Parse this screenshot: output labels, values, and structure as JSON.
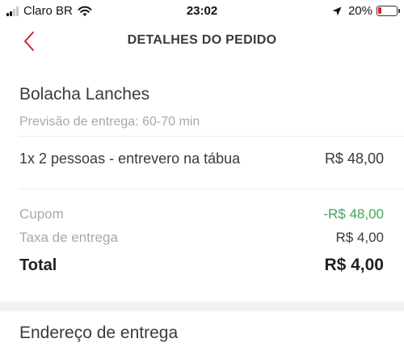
{
  "status_bar": {
    "carrier": "Claro BR",
    "time": "23:02",
    "battery_percent": "20%",
    "battery_level": 0.2,
    "icons": [
      "signal-icon",
      "wifi-icon",
      "location-arrow-icon",
      "battery-icon"
    ]
  },
  "nav": {
    "title": "DETALHES DO PEDIDO",
    "back_icon": "chevron-left-icon",
    "accent_color": "#c8262d"
  },
  "order": {
    "restaurant": "Bolacha Lanches",
    "eta": "Previsão de entrega: 60-70 min",
    "items": [
      {
        "description": "1x 2 pessoas - entrevero na tábua",
        "price": "R$ 48,00"
      }
    ],
    "summary": {
      "coupon_label": "Cupom",
      "coupon_value": "-R$ 48,00",
      "delivery_label": "Taxa de entrega",
      "delivery_value": "R$ 4,00",
      "total_label": "Total",
      "total_value": "R$ 4,00"
    },
    "colors": {
      "discount": "#3fa45c",
      "muted": "#a8a8a8"
    }
  },
  "address_section": {
    "title": "Endereço de entrega"
  }
}
